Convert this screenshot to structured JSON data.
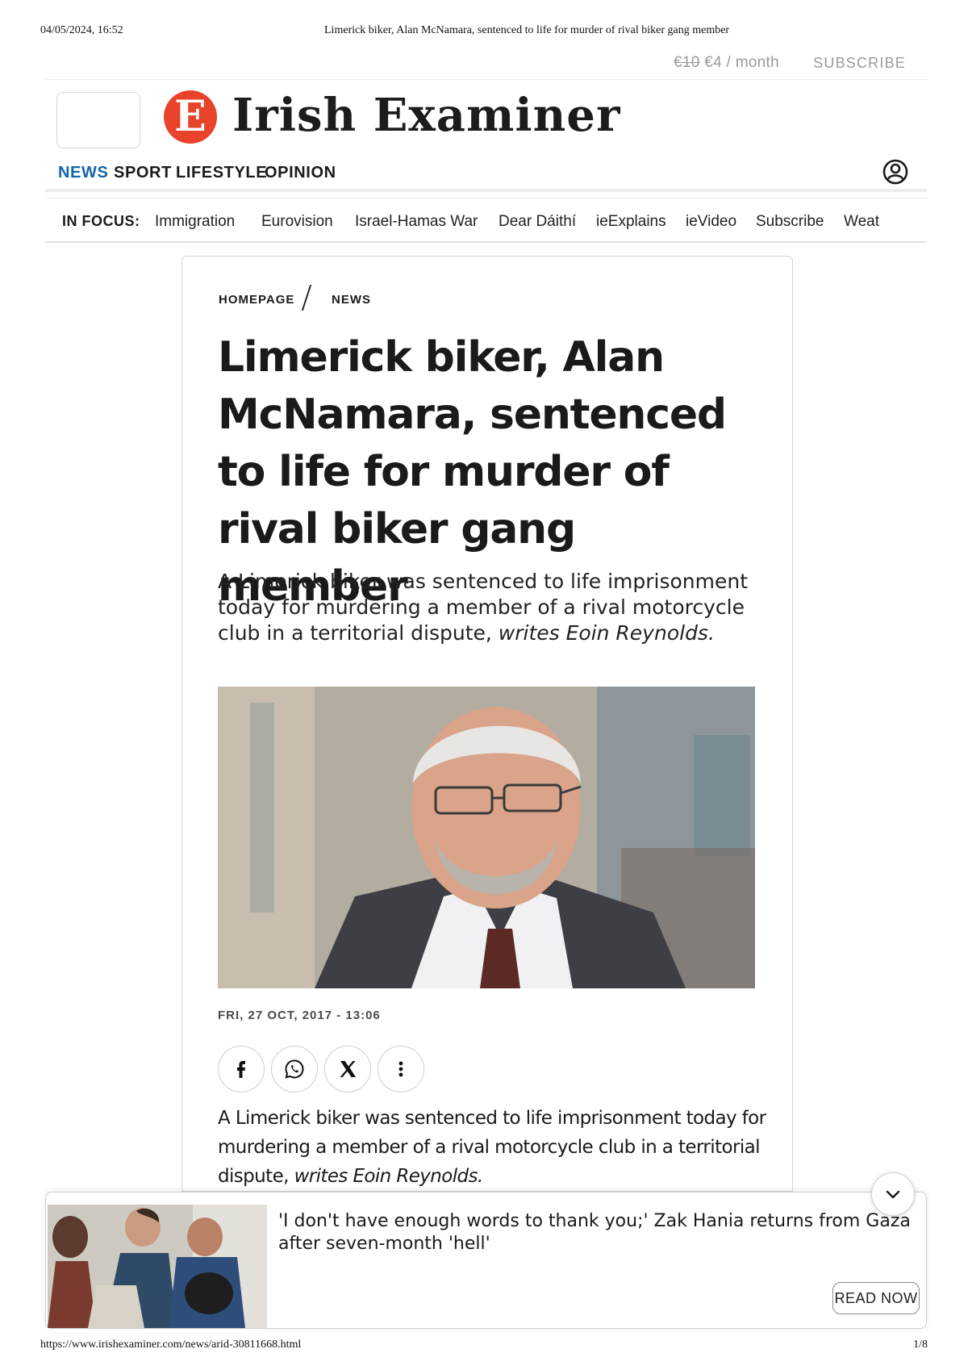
{
  "print": {
    "date": "04/05/2024, 16:52",
    "doc_title": "Limerick biker, Alan McNamara, sentenced to life for murder of rival biker gang member",
    "url": "https://www.irishexaminer.com/news/arid-30811668.html",
    "page": "1/8"
  },
  "subscribe_bar": {
    "price_old": "€10",
    "price_new": "€4 / month",
    "subscribe_label": "SUBSCRIBE"
  },
  "masthead": {
    "logo_letter": "E",
    "logo_text": "Irish Examiner",
    "brand_color": "#e8442b"
  },
  "main_nav": {
    "items": [
      "NEWS",
      "SPORT",
      "LIFESTYLE",
      "OPINION"
    ],
    "active": "NEWS",
    "active_color": "#1466a6",
    "account_icon": "user-icon"
  },
  "focus_bar": {
    "label": "IN FOCUS:",
    "items": [
      "Immigration",
      "Eurovision",
      "Israel-Hamas War",
      "Dear Dáithí",
      "ieExplains",
      "ieVideo",
      "Subscribe",
      "Weat"
    ]
  },
  "article": {
    "breadcrumb": [
      "HOMEPAGE",
      "NEWS"
    ],
    "headline": "Limerick biker, Alan McNamara, sentenced to life for murder of rival biker gang member",
    "standfirst": "A Limerick biker was sentenced to life imprisonment today for murdering a member of a rival motorcycle club in a territorial dispute,",
    "standfirst_byline": "writes Eoin Reynolds.",
    "date": "FRI, 27 OCT, 2017 - 13:06",
    "share_icons": [
      "facebook-icon",
      "whatsapp-icon",
      "x-icon",
      "more-icon"
    ],
    "body_text": "A Limerick biker was sentenced to life imprisonment today for murdering a member of a rival motorcycle club in a territorial dispute,",
    "body_byline": "writes Eoin Reynolds."
  },
  "recommendation": {
    "title": "'I don't have enough words to thank you;' Zak Hania returns from Gaza after seven-month 'hell'",
    "button_label": "READ NOW",
    "collapse_icon": "chevron-down-icon"
  }
}
